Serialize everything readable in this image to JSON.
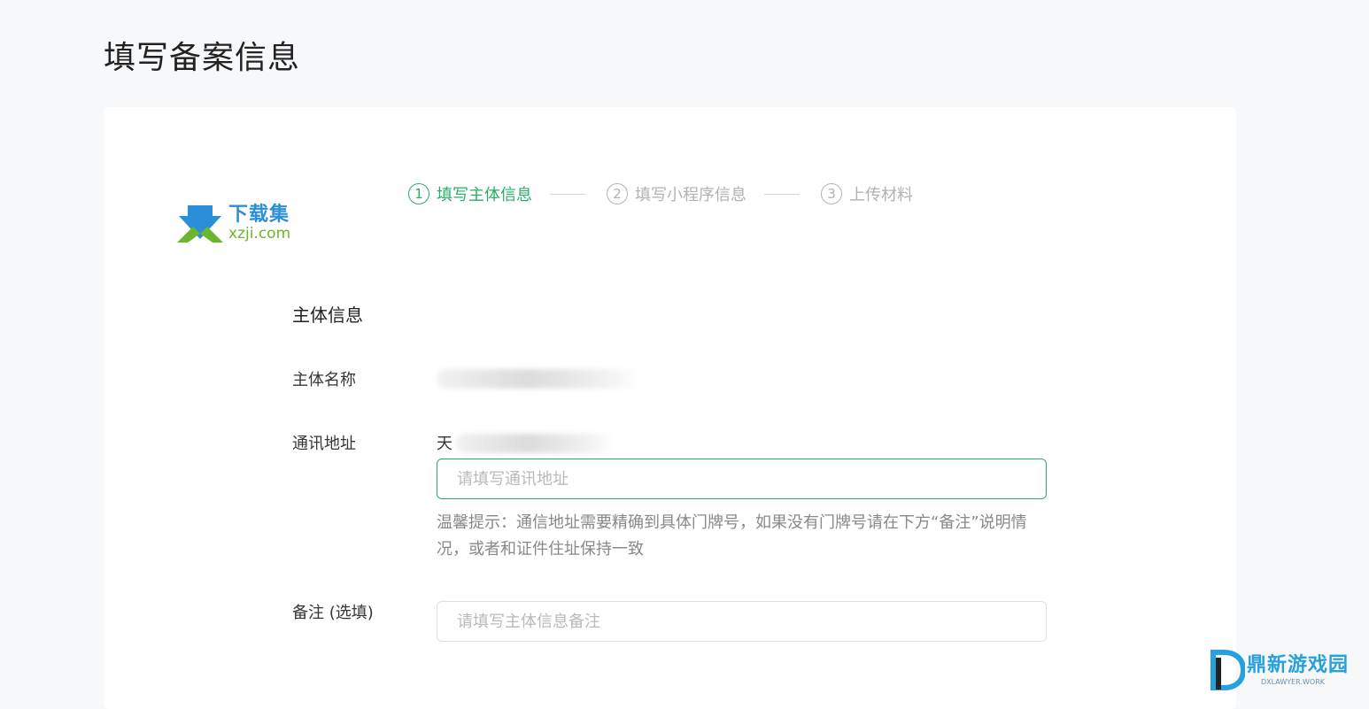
{
  "page": {
    "title": "填写备案信息"
  },
  "watermark": {
    "logo_cn": "下载集",
    "logo_en": "xzji.com",
    "corner_cn": "鼎新游戏园",
    "corner_en": "DXLAWYER.WORK"
  },
  "steps": [
    {
      "number": "1",
      "label": "填写主体信息",
      "active": true
    },
    {
      "number": "2",
      "label": "填写小程序信息",
      "active": false
    },
    {
      "number": "3",
      "label": "上传材料",
      "active": false
    }
  ],
  "form": {
    "section_title": "主体信息",
    "subject_name": {
      "label": "主体名称",
      "value": ""
    },
    "address": {
      "label": "通讯地址",
      "value_prefix": "天",
      "placeholder": "请填写通讯地址",
      "tip": "温馨提示：通信地址需要精确到具体门牌号，如果没有门牌号请在下方“备注”说明情况，或者和证件住址保持一致"
    },
    "remark": {
      "label": "备注 (选填)",
      "placeholder": "请填写主体信息备注"
    }
  },
  "colors": {
    "accent": "#2aae67",
    "background": "#f7f8fa",
    "card": "#ffffff",
    "muted": "#b2b2b2"
  }
}
